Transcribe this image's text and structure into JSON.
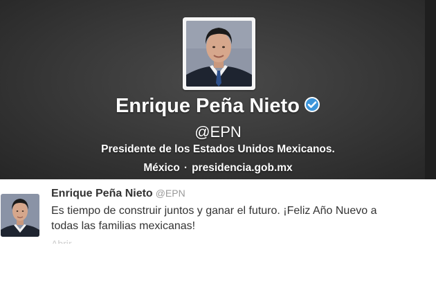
{
  "profile": {
    "name": "Enrique Peña Nieto",
    "handle": "@EPN",
    "bio": "Presidente de los Estados Unidos Mexicanos.",
    "location": "México",
    "separator": "·",
    "url": "presidencia.gob.mx",
    "verified_icon": "verified-badge-icon",
    "verified_color": "#1da1f2"
  },
  "tweet": {
    "name": "Enrique Peña Nieto",
    "handle": "@EPN",
    "text_line1": "Es tiempo de construir juntos y ganar el futuro. ¡Feliz Año Nuevo a",
    "text_line2": "todas las familias mexicanas!",
    "faded_text": "Abrir"
  }
}
